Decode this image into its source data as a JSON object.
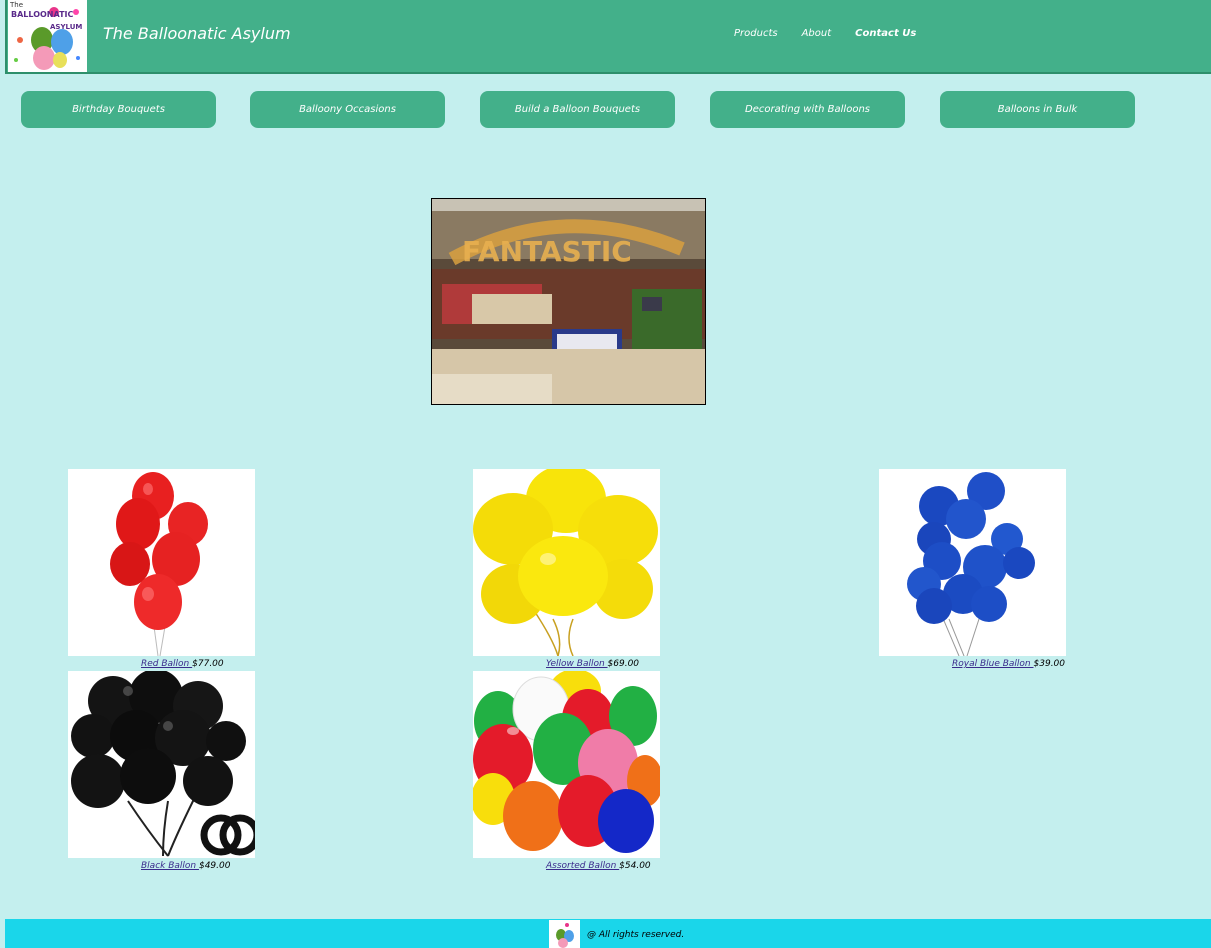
{
  "header": {
    "logo_text_line1": "The",
    "logo_text_line2": "BALLOONATIC",
    "logo_text_line3": "ASYLUM",
    "title": "The Balloonatic Asylum",
    "nav": [
      {
        "label": "Products"
      },
      {
        "label": "About"
      },
      {
        "label": "Contact Us"
      }
    ]
  },
  "subnav": [
    {
      "label": "Birthday Bouquets"
    },
    {
      "label": "Balloony Occasions"
    },
    {
      "label": "Build a Balloon Bouquets"
    },
    {
      "label": "Decorating with Balloons"
    },
    {
      "label": "Balloons in Bulk"
    }
  ],
  "hero": {
    "sign_text": "FANTASTIC"
  },
  "products": [
    {
      "name": "Red Ballon ",
      "price": "$77.00"
    },
    {
      "name": "Yellow Ballon ",
      "price": "$69.00"
    },
    {
      "name": "Royal Blue Ballon ",
      "price": "$39.00"
    },
    {
      "name": "Black Ballon ",
      "price": "$49.00"
    },
    {
      "name": "Assorted Ballon ",
      "price": "$54.00"
    }
  ],
  "footer": {
    "text": "@ All rights reserved."
  },
  "colors": {
    "page_bg": "#c4efee",
    "header_bg": "#43b08a",
    "footer_bg": "#1ad6ea"
  }
}
